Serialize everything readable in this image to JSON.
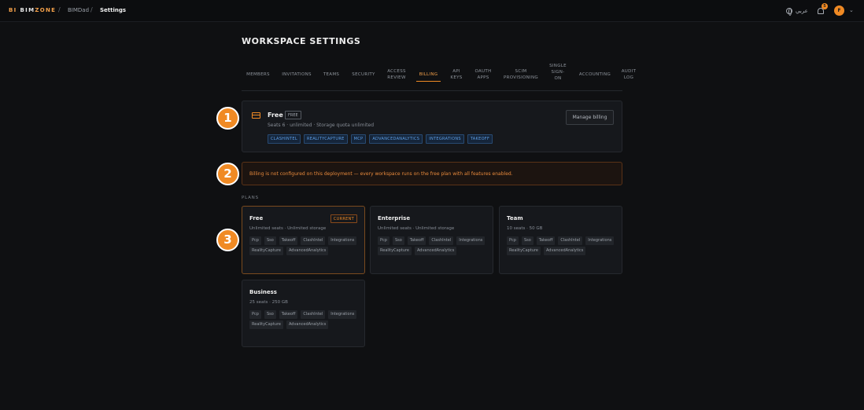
{
  "topbar": {
    "brand_prefix": "BI",
    "brand_name_a": "BIM",
    "brand_name_b": "ZONE",
    "breadcrumbs": [
      "BIMDad",
      "Settings"
    ],
    "language_label": "عربي",
    "notification_count": "5",
    "avatar_initial": "F"
  },
  "page": {
    "title": "WORKSPACE SETTINGS",
    "tabs": [
      {
        "label": "MEMBERS"
      },
      {
        "label": "INVITATIONS"
      },
      {
        "label": "TEAMS"
      },
      {
        "label": "SECURITY"
      },
      {
        "label": "ACCESS\nREVIEW"
      },
      {
        "label": "BILLING",
        "active": true
      },
      {
        "label": "API\nKEYS"
      },
      {
        "label": "OAUTH\nAPPS"
      },
      {
        "label": "SCIM\nPROVISIONING"
      },
      {
        "label": "SINGLE\nSIGN-\nON"
      },
      {
        "label": "ACCOUNTING"
      },
      {
        "label": "AUDIT\nLOG"
      }
    ]
  },
  "current_plan": {
    "name": "Free",
    "badge": "FREE",
    "meta": "Seats 6 · unlimited · Storage quota unlimited",
    "features": [
      "CLASHINTEL",
      "REALITYCAPTURE",
      "MCP",
      "ADVANCEDANALYTICS",
      "INTEGRATIONS",
      "TAKEOFF"
    ],
    "manage_label": "Manage billing"
  },
  "notice": {
    "text": "Billing is not configured on this deployment — every workspace runs on the free plan with all features enabled."
  },
  "plans": {
    "section_label": "PLANS",
    "items": [
      {
        "name": "Free",
        "badge": "CURRENT",
        "meta": "Unlimited seats · Unlimited storage",
        "tags": [
          "Pcp",
          "Sso",
          "Takeoff",
          "ClashIntel",
          "Integrations",
          "RealityCapture",
          "AdvancedAnalytics"
        ]
      },
      {
        "name": "Enterprise",
        "meta": "Unlimited seats · Unlimited storage",
        "tags": [
          "Pcp",
          "Sso",
          "Takeoff",
          "ClashIntel",
          "Integrations",
          "RealityCapture",
          "AdvancedAnalytics"
        ]
      },
      {
        "name": "Team",
        "meta": "10 seats · 50 GB",
        "tags": [
          "Pcp",
          "Sso",
          "Takeoff",
          "ClashIntel",
          "Integrations",
          "RealityCapture",
          "AdvancedAnalytics"
        ]
      },
      {
        "name": "Business",
        "meta": "25 seats · 250 GB",
        "tags": [
          "Pcp",
          "Sso",
          "Takeoff",
          "ClashIntel",
          "Integrations",
          "RealityCapture",
          "AdvancedAnalytics"
        ]
      }
    ]
  },
  "markers": [
    "1",
    "2",
    "3"
  ],
  "colors": {
    "accent": "#f08a24",
    "background": "#0f1012",
    "card": "#16181c",
    "feature_chip": "#5ea0e8",
    "notice_text": "#e98a3c"
  },
  "icons": [
    "globe-icon",
    "bell-icon",
    "chevron-down-icon",
    "credit-card-icon"
  ]
}
